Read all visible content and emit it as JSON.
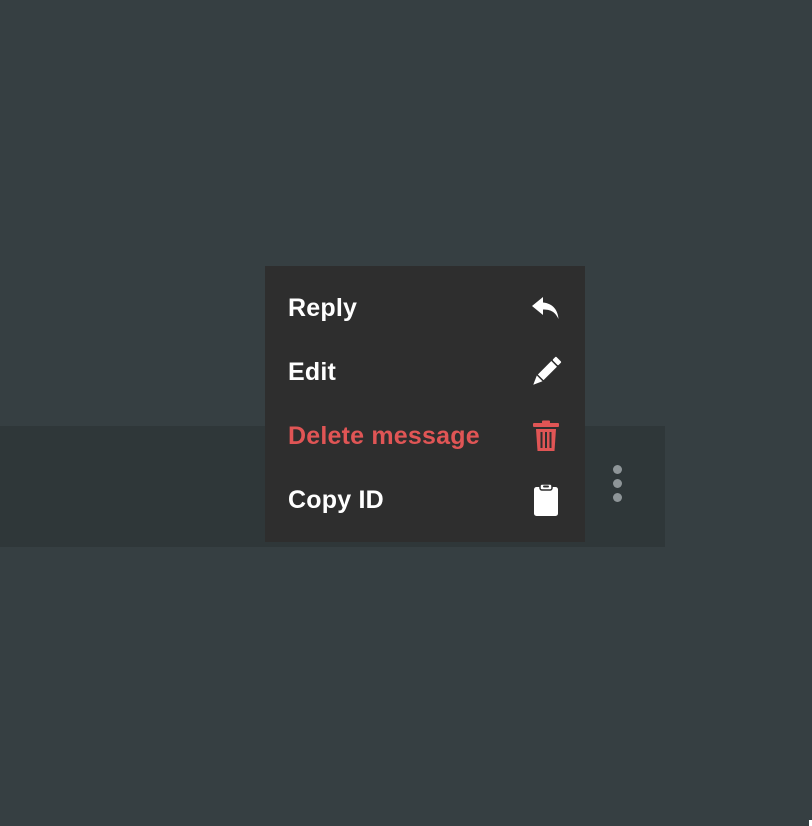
{
  "menu": {
    "items": [
      {
        "label": "Reply",
        "icon": "reply-icon",
        "danger": false
      },
      {
        "label": "Edit",
        "icon": "pencil-icon",
        "danger": false
      },
      {
        "label": "Delete message",
        "icon": "trash-icon",
        "danger": true
      },
      {
        "label": "Copy ID",
        "icon": "clipboard-icon",
        "danger": false
      }
    ]
  },
  "more_button": {
    "icon": "vertical-ellipsis-icon"
  },
  "colors": {
    "background": "#363f42",
    "message_row": "#2f3739",
    "menu_background": "#2e2e2e",
    "text": "#ffffff",
    "danger": "#e05555",
    "dots": "#8e9598"
  }
}
